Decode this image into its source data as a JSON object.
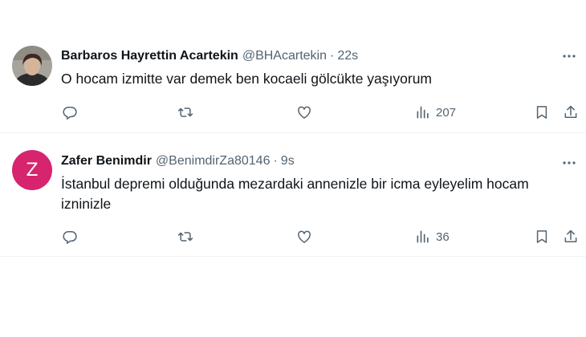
{
  "tweets": [
    {
      "name": "Barbaros Hayrettin Acartekin",
      "handle": "@BHAcartekin",
      "separator": "·",
      "time": "22s",
      "text": "O hocam izmitte var demek ben kocaeli gölcükte yaşıyorum",
      "views": "207",
      "avatar_type": "photo"
    },
    {
      "name": "Zafer Benimdir",
      "handle": "@BenimdirZa80146",
      "separator": "·",
      "time": "9s",
      "text": "İstanbul depremi olduğunda mezardaki annenizle bir icma eyleyelim hocam izninizle",
      "views": "36",
      "avatar_type": "letter",
      "avatar_letter": "Z",
      "avatar_color": "#d6246e"
    }
  ],
  "icons": {
    "reply": "reply-icon",
    "retweet": "retweet-icon",
    "like": "heart-icon",
    "views": "views-icon",
    "bookmark": "bookmark-icon",
    "share": "share-icon",
    "more": "more-icon"
  },
  "colors": {
    "text": "#0f1419",
    "secondary": "#536471",
    "divider": "#eff3f4"
  }
}
